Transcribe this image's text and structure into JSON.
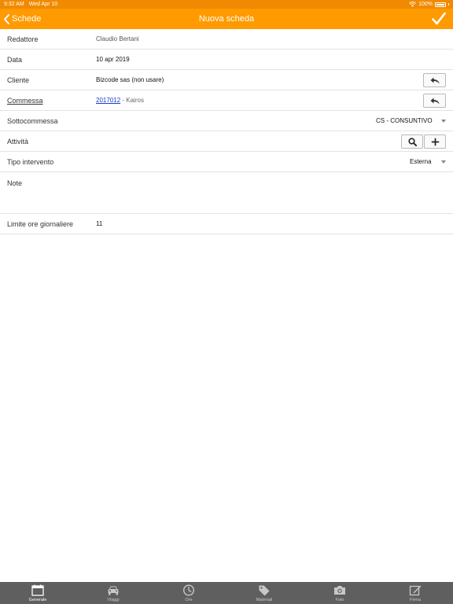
{
  "status_bar": {
    "time": "9:32 AM",
    "date": "Wed Apr 10",
    "battery": "100%"
  },
  "nav": {
    "back_label": "Schede",
    "title": "Nuova scheda"
  },
  "form": {
    "redattore": {
      "label": "Redattore",
      "value": "Claudio Bertani"
    },
    "data": {
      "label": "Data",
      "value": "10 apr 2019"
    },
    "cliente": {
      "label": "Cliente",
      "value": "Bizcode sas (non usare)"
    },
    "commessa": {
      "label": "Commessa",
      "code": "2017012",
      "suffix": " - Kairos"
    },
    "sottocommessa": {
      "label": "Sottocommessa",
      "value": "CS - CONSUNTIVO"
    },
    "attivita": {
      "label": "Attività"
    },
    "tipo_intervento": {
      "label": "Tipo intervento",
      "value": "Esterna"
    },
    "note": {
      "label": "Note",
      "value": ""
    },
    "limite_ore": {
      "label": "Limite ore giornaliere",
      "value": "11"
    }
  },
  "tabs": [
    {
      "label": "Generale",
      "icon": "calendar-icon",
      "active": true
    },
    {
      "label": "Viaggi",
      "icon": "car-icon",
      "active": false
    },
    {
      "label": "Ore",
      "icon": "clock-icon",
      "active": false
    },
    {
      "label": "Materiali",
      "icon": "tag-icon",
      "active": false
    },
    {
      "label": "Foto",
      "icon": "camera-icon",
      "active": false
    },
    {
      "label": "Firma",
      "icon": "signature-icon",
      "active": false
    }
  ],
  "colors": {
    "nav_orange": "#ff9a00",
    "status_orange": "#f18a00",
    "tab_bar": "#5f5f5f",
    "link_blue": "#1a3fc9"
  }
}
